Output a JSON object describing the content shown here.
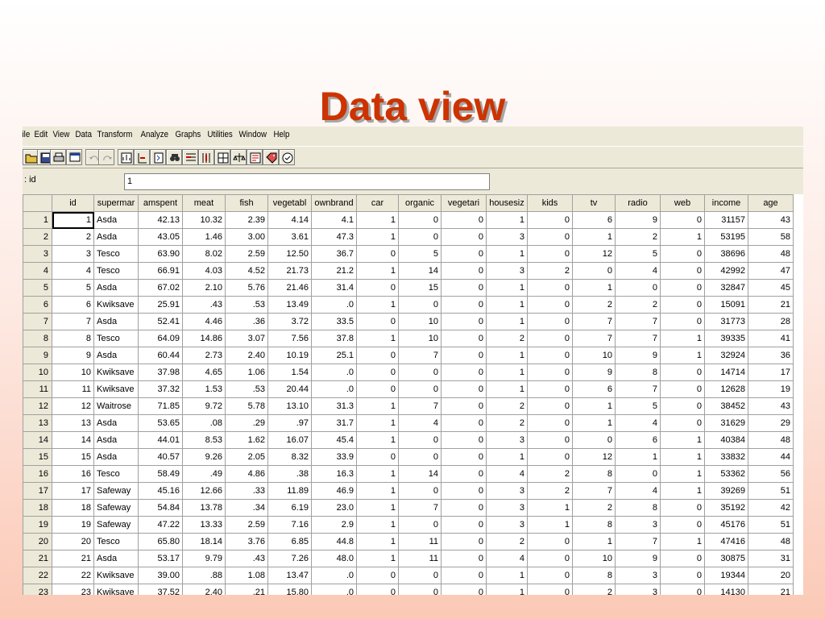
{
  "slide": {
    "title": "Data view"
  },
  "menu": [
    "ile",
    "Edit",
    "View",
    "Data",
    "Transform",
    "Analyze",
    "Graphs",
    "Utilities",
    "Window",
    "Help"
  ],
  "toolbar": {
    "buttons": [
      "open-icon",
      "save-icon",
      "print-icon",
      "dialog-recall-icon",
      "undo-icon",
      "redo-icon",
      "goto-chart-icon",
      "goto-case-icon",
      "variables-icon",
      "find-icon",
      "insert-case-icon",
      "insert-variable-icon",
      "split-file-icon",
      "weight-cases-icon",
      "select-cases-icon",
      "value-labels-icon",
      "use-sets-icon"
    ]
  },
  "cell_editor": {
    "ref": ": id",
    "value": "1"
  },
  "columns": [
    "id",
    "supermar",
    "amspent",
    "meat",
    "fish",
    "vegetabl",
    "ownbrand",
    "car",
    "organic",
    "vegetari",
    "housesiz",
    "kids",
    "tv",
    "radio",
    "web",
    "income",
    "age"
  ],
  "rows": [
    [
      "1",
      "1",
      "Asda",
      "42.13",
      "10.32",
      "2.39",
      "4.14",
      "4.1",
      "1",
      "0",
      "0",
      "1",
      "0",
      "6",
      "9",
      "0",
      "31157",
      "43"
    ],
    [
      "2",
      "2",
      "Asda",
      "43.05",
      "1.46",
      "3.00",
      "3.61",
      "47.3",
      "1",
      "0",
      "0",
      "3",
      "0",
      "1",
      "2",
      "1",
      "53195",
      "58"
    ],
    [
      "3",
      "3",
      "Tesco",
      "63.90",
      "8.02",
      "2.59",
      "12.50",
      "36.7",
      "0",
      "5",
      "0",
      "1",
      "0",
      "12",
      "5",
      "0",
      "38696",
      "48"
    ],
    [
      "4",
      "4",
      "Tesco",
      "66.91",
      "4.03",
      "4.52",
      "21.73",
      "21.2",
      "1",
      "14",
      "0",
      "3",
      "2",
      "0",
      "4",
      "0",
      "42992",
      "47"
    ],
    [
      "5",
      "5",
      "Asda",
      "67.02",
      "2.10",
      "5.76",
      "21.46",
      "31.4",
      "0",
      "15",
      "0",
      "1",
      "0",
      "1",
      "0",
      "0",
      "32847",
      "45"
    ],
    [
      "6",
      "6",
      "Kwiksave",
      "25.91",
      ".43",
      ".53",
      "13.49",
      ".0",
      "1",
      "0",
      "0",
      "1",
      "0",
      "2",
      "2",
      "0",
      "15091",
      "21"
    ],
    [
      "7",
      "7",
      "Asda",
      "52.41",
      "4.46",
      ".36",
      "3.72",
      "33.5",
      "0",
      "10",
      "0",
      "1",
      "0",
      "7",
      "7",
      "0",
      "31773",
      "28"
    ],
    [
      "8",
      "8",
      "Tesco",
      "64.09",
      "14.86",
      "3.07",
      "7.56",
      "37.8",
      "1",
      "10",
      "0",
      "2",
      "0",
      "7",
      "7",
      "1",
      "39335",
      "41"
    ],
    [
      "9",
      "9",
      "Asda",
      "60.44",
      "2.73",
      "2.40",
      "10.19",
      "25.1",
      "0",
      "7",
      "0",
      "1",
      "0",
      "10",
      "9",
      "1",
      "32924",
      "36"
    ],
    [
      "10",
      "10",
      "Kwiksave",
      "37.98",
      "4.65",
      "1.06",
      "1.54",
      ".0",
      "0",
      "0",
      "0",
      "1",
      "0",
      "9",
      "8",
      "0",
      "14714",
      "17"
    ],
    [
      "11",
      "11",
      "Kwiksave",
      "37.32",
      "1.53",
      ".53",
      "20.44",
      ".0",
      "0",
      "0",
      "0",
      "1",
      "0",
      "6",
      "7",
      "0",
      "12628",
      "19"
    ],
    [
      "12",
      "12",
      "Waitrose",
      "71.85",
      "9.72",
      "5.78",
      "13.10",
      "31.3",
      "1",
      "7",
      "0",
      "2",
      "0",
      "1",
      "5",
      "0",
      "38452",
      "43"
    ],
    [
      "13",
      "13",
      "Asda",
      "53.65",
      ".08",
      ".29",
      ".97",
      "31.7",
      "1",
      "4",
      "0",
      "2",
      "0",
      "1",
      "4",
      "0",
      "31629",
      "29"
    ],
    [
      "14",
      "14",
      "Asda",
      "44.01",
      "8.53",
      "1.62",
      "16.07",
      "45.4",
      "1",
      "0",
      "0",
      "3",
      "0",
      "0",
      "6",
      "1",
      "40384",
      "48"
    ],
    [
      "15",
      "15",
      "Asda",
      "40.57",
      "9.26",
      "2.05",
      "8.32",
      "33.9",
      "0",
      "0",
      "0",
      "1",
      "0",
      "12",
      "1",
      "1",
      "33832",
      "44"
    ],
    [
      "16",
      "16",
      "Tesco",
      "58.49",
      ".49",
      "4.86",
      ".38",
      "16.3",
      "1",
      "14",
      "0",
      "4",
      "2",
      "8",
      "0",
      "1",
      "53362",
      "56"
    ],
    [
      "17",
      "17",
      "Safeway",
      "45.16",
      "12.66",
      ".33",
      "11.89",
      "46.9",
      "1",
      "0",
      "0",
      "3",
      "2",
      "7",
      "4",
      "1",
      "39269",
      "51"
    ],
    [
      "18",
      "18",
      "Safeway",
      "54.84",
      "13.78",
      ".34",
      "6.19",
      "23.0",
      "1",
      "7",
      "0",
      "3",
      "1",
      "2",
      "8",
      "0",
      "35192",
      "42"
    ],
    [
      "19",
      "19",
      "Safeway",
      "47.22",
      "13.33",
      "2.59",
      "7.16",
      "2.9",
      "1",
      "0",
      "0",
      "3",
      "1",
      "8",
      "3",
      "0",
      "45176",
      "51"
    ],
    [
      "20",
      "20",
      "Tesco",
      "65.80",
      "18.14",
      "3.76",
      "6.85",
      "44.8",
      "1",
      "11",
      "0",
      "2",
      "0",
      "1",
      "7",
      "1",
      "47416",
      "48"
    ],
    [
      "21",
      "21",
      "Asda",
      "53.17",
      "9.79",
      ".43",
      "7.26",
      "48.0",
      "1",
      "11",
      "0",
      "4",
      "0",
      "10",
      "9",
      "0",
      "30875",
      "31"
    ],
    [
      "22",
      "22",
      "Kwiksave",
      "39.00",
      ".88",
      "1.08",
      "13.47",
      ".0",
      "0",
      "0",
      "0",
      "1",
      "0",
      "8",
      "3",
      "0",
      "19344",
      "20"
    ],
    [
      "23",
      "23",
      "Kwiksave",
      "37.52",
      "2.40",
      ".21",
      "15.80",
      ".0",
      "0",
      "0",
      "0",
      "1",
      "0",
      "2",
      "3",
      "0",
      "14130",
      "21"
    ]
  ]
}
